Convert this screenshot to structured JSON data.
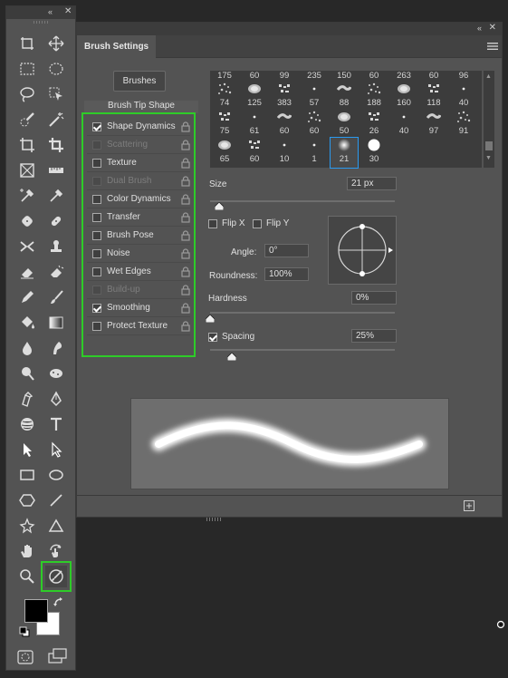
{
  "toolbar": {
    "collapse_label": "«",
    "close_label": "✕",
    "tools": [
      {
        "name": "artboard-tool-icon"
      },
      {
        "name": "move-tool-icon"
      },
      {
        "name": "rectangular-marquee-icon"
      },
      {
        "name": "elliptical-marquee-icon"
      },
      {
        "name": "lasso-icon"
      },
      {
        "name": "object-selection-icon"
      },
      {
        "name": "quick-selection-icon"
      },
      {
        "name": "magic-wand-icon"
      },
      {
        "name": "crop-icon"
      },
      {
        "name": "crop-tool-icon"
      },
      {
        "name": "frame-icon"
      },
      {
        "name": "ruler-icon"
      },
      {
        "name": "color-sampler-icon"
      },
      {
        "name": "eyedropper-icon"
      },
      {
        "name": "spot-healing-icon"
      },
      {
        "name": "bandage-icon"
      },
      {
        "name": "content-aware-move-icon"
      },
      {
        "name": "clone-stamp-icon"
      },
      {
        "name": "eraser-icon"
      },
      {
        "name": "background-eraser-icon"
      },
      {
        "name": "pencil-icon"
      },
      {
        "name": "brush-icon"
      },
      {
        "name": "paint-bucket-icon"
      },
      {
        "name": "gradient-icon"
      },
      {
        "name": "blur-icon"
      },
      {
        "name": "smudge-icon"
      },
      {
        "name": "dodge-icon"
      },
      {
        "name": "sponge-icon"
      },
      {
        "name": "freeform-pen-icon"
      },
      {
        "name": "pen-icon"
      },
      {
        "name": "texture-brush-icon"
      },
      {
        "name": "type-icon"
      },
      {
        "name": "path-selection-icon"
      },
      {
        "name": "direct-selection-icon"
      },
      {
        "name": "rectangle-icon"
      },
      {
        "name": "ellipse-icon"
      },
      {
        "name": "polygon-icon"
      },
      {
        "name": "line-icon"
      },
      {
        "name": "custom-shape-icon"
      },
      {
        "name": "triangle-icon"
      },
      {
        "name": "hand-icon"
      },
      {
        "name": "rotate-view-icon"
      },
      {
        "name": "zoom-icon"
      },
      {
        "name": "mixer-brush-icon"
      }
    ],
    "colors": {
      "foreground": "#000000",
      "background": "#ffffff"
    },
    "bottom": [
      {
        "name": "quick-mask-icon"
      },
      {
        "name": "screen-mode-icon"
      }
    ]
  },
  "panel": {
    "title": "Brush Settings",
    "collapse_label": "«",
    "close_label": "✕",
    "brushes_button": "Brushes",
    "tip_shape_label": "Brush Tip Shape",
    "options": [
      {
        "label": "Shape Dynamics",
        "checked": true,
        "disabled": false
      },
      {
        "label": "Scattering",
        "checked": false,
        "disabled": true
      },
      {
        "label": "Texture",
        "checked": false,
        "disabled": false
      },
      {
        "label": "Dual Brush",
        "checked": false,
        "disabled": true
      },
      {
        "label": "Color Dynamics",
        "checked": false,
        "disabled": false
      },
      {
        "label": "Transfer",
        "checked": false,
        "disabled": false
      },
      {
        "label": "Brush Pose",
        "checked": false,
        "disabled": false
      },
      {
        "label": "Noise",
        "checked": false,
        "disabled": false
      },
      {
        "label": "Wet Edges",
        "checked": false,
        "disabled": false
      },
      {
        "label": "Build-up",
        "checked": false,
        "disabled": true
      },
      {
        "label": "Smoothing",
        "checked": true,
        "disabled": false
      },
      {
        "label": "Protect Texture",
        "checked": false,
        "disabled": false
      }
    ],
    "brush_tips": {
      "row1": [
        "175",
        "60",
        "99",
        "235",
        "150",
        "60",
        "263",
        "60",
        "96"
      ],
      "row2": [
        "74",
        "125",
        "383",
        "57",
        "88",
        "188",
        "160",
        "118",
        "40"
      ],
      "row3": [
        "75",
        "61",
        "60",
        "60",
        "50",
        "26",
        "40",
        "97",
        "91"
      ],
      "row4": [
        "65",
        "60",
        "10",
        "1",
        "21",
        "30"
      ],
      "selected": "21"
    },
    "size": {
      "label": "Size",
      "value": "21 px",
      "fraction": 0.05
    },
    "flip_x": {
      "label": "Flip X",
      "checked": false
    },
    "flip_y": {
      "label": "Flip Y",
      "checked": false
    },
    "angle": {
      "label": "Angle:",
      "value": "0°"
    },
    "roundness": {
      "label": "Roundness:",
      "value": "100%"
    },
    "hardness": {
      "label": "Hardness",
      "value": "0%",
      "fraction": 0.0
    },
    "spacing": {
      "label": "Spacing",
      "value": "25%",
      "checked": true,
      "fraction": 0.12
    }
  }
}
